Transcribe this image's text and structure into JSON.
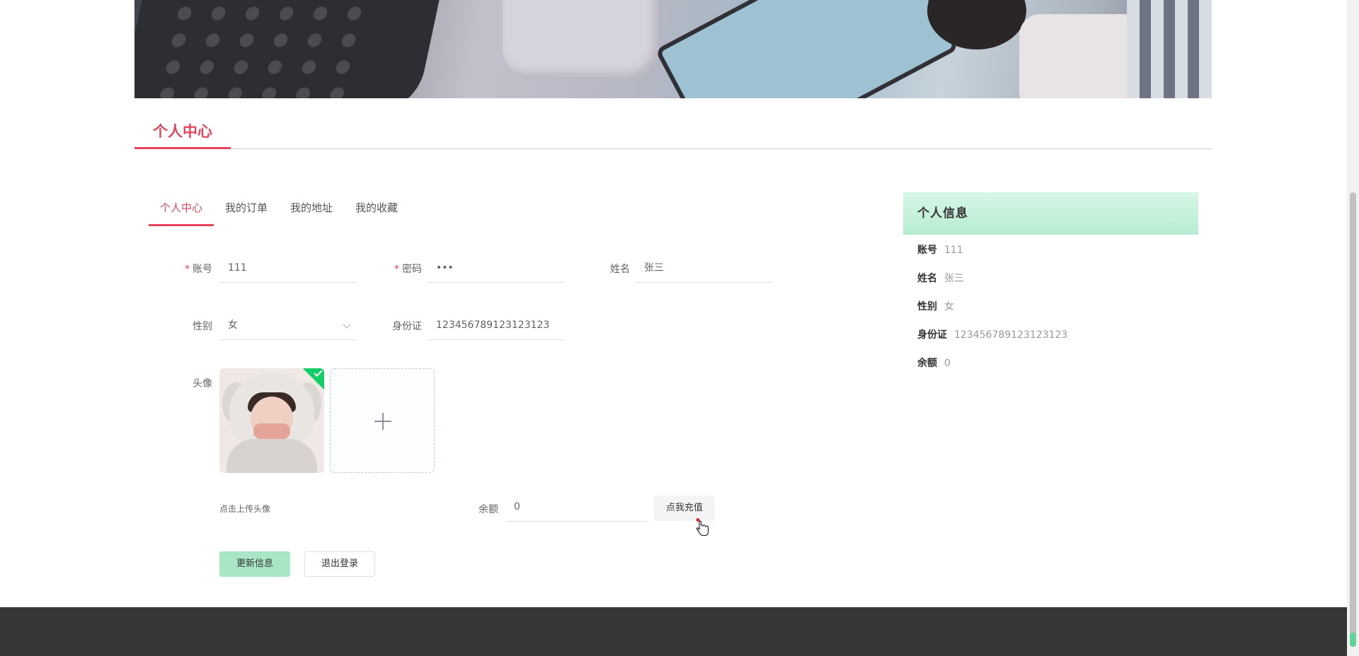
{
  "section": {
    "title": "个人中心"
  },
  "tabs": [
    {
      "label": "个人中心",
      "active": true
    },
    {
      "label": "我的订单",
      "active": false
    },
    {
      "label": "我的地址",
      "active": false
    },
    {
      "label": "我的收藏",
      "active": false
    }
  ],
  "form": {
    "account": {
      "label": "账号",
      "required": "*",
      "value": "111"
    },
    "password": {
      "label": "密码",
      "required": "*",
      "value": "•••"
    },
    "name": {
      "label": "姓名",
      "value": "张三"
    },
    "gender": {
      "label": "性别",
      "value": "女"
    },
    "id_card": {
      "label": "身份证",
      "value": "123456789123123123"
    },
    "avatar": {
      "label": "头像",
      "tip": "点击上传头像"
    },
    "balance": {
      "label": "余额",
      "value": "0"
    },
    "recharge_button": "点我充值",
    "update_button": "更新信息",
    "logout_button": "退出登录"
  },
  "info_card": {
    "title": "个人信息",
    "rows": [
      {
        "key": "账号",
        "value": "111"
      },
      {
        "key": "姓名",
        "value": "张三"
      },
      {
        "key": "性别",
        "value": "女"
      },
      {
        "key": "身份证",
        "value": "123456789123123123"
      },
      {
        "key": "余额",
        "value": "0"
      }
    ]
  },
  "colors": {
    "accent": "#e6445c",
    "success": "#13ce66",
    "update_button": "#a8e6c6",
    "footer": "#363636"
  },
  "icons": {
    "select": "chevron-down-icon",
    "upload": "plus-icon",
    "uploaded": "check-icon",
    "cursor": "hand-pointer-icon"
  }
}
